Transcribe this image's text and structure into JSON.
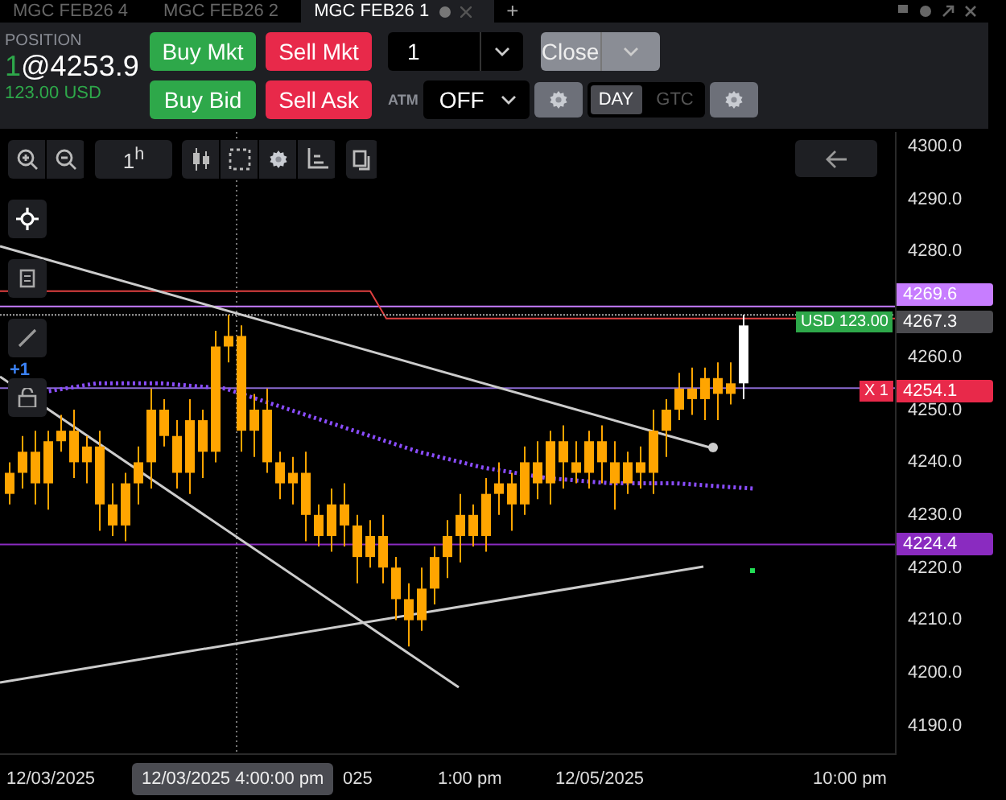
{
  "tabs": [
    {
      "label": "MGC FEB26 4",
      "selected": false
    },
    {
      "label": "MGC FEB26 2",
      "selected": false
    },
    {
      "label": "MGC FEB26 1",
      "selected": true
    }
  ],
  "add_tab": "+",
  "position": {
    "label": "POSITION",
    "quantity": "1",
    "price": "@4253.9",
    "pnl": "123.00 USD"
  },
  "order_buttons": [
    {
      "label": "Buy Mkt",
      "kind": "buy"
    },
    {
      "label": "Sell Mkt",
      "kind": "sell"
    },
    {
      "label": "Buy Bid",
      "kind": "buy"
    },
    {
      "label": "Sell Ask",
      "kind": "sell"
    }
  ],
  "quantity": {
    "value": "1"
  },
  "close_button": "Close",
  "atm": {
    "label": "ATM",
    "value": "OFF"
  },
  "tif": [
    {
      "label": "DAY",
      "selected": true
    },
    {
      "label": "GTC",
      "selected": false
    }
  ],
  "chart": {
    "interval": "1$^{h}$",
    "badge": "+1",
    "price_ticks": [
      "4300.0",
      "4290.0",
      "4280.0",
      "4260.0",
      "4250.0",
      "4240.0",
      "4230.0",
      "4220.0",
      "4210.0",
      "4200.0",
      "4190.0"
    ],
    "price_tags": [
      {
        "text": "4269.6",
        "color": "#c77dff"
      },
      {
        "text": "4267.3",
        "color": "#4a4a4e"
      },
      {
        "text": "4254.1",
        "color": "#e8294a"
      },
      {
        "text": "4224.4",
        "color": "#8a2bc0"
      }
    ],
    "order_tags": [
      {
        "text": "USD 123.00",
        "color": "#2ea84a"
      },
      {
        "text": "X 1",
        "color": "#e8294a"
      }
    ],
    "time_labels": [
      "12/03/2025",
      "025",
      "1:00 pm",
      "12/05/2025",
      "10:00 pm"
    ],
    "crosshair_time": "12/03/2025 4:00:00 pm"
  }
}
